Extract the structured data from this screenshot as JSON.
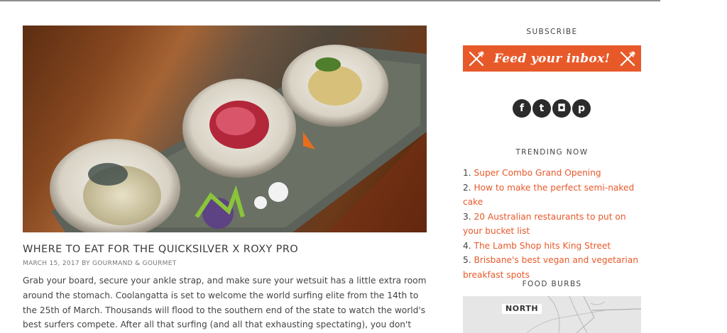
{
  "article": {
    "title": "WHERE TO EAT FOR THE QUICKSILVER X ROXY PRO",
    "meta": "MARCH 15, 2017 BY GOURMAND & GOURMET",
    "excerpt": "Grab your board, secure your ankle strap, and make sure your wetsuit has a little extra room around the stomach. Coolangatta is set to welcome the world surfing elite from the 14th to the 25th of March. Thousands will flood to the southern end of the state to watch the world's best surfers compete. After all that surfing (and all that exhausting spectating), you don't want to be hunting around all day and"
  },
  "sidebar": {
    "subscribe": {
      "heading": "SUBSCRIBE",
      "banner_text": "Feed your inbox!",
      "accent": "#e8592a"
    },
    "socials": [
      {
        "icon": "facebook-icon",
        "glyph": "f"
      },
      {
        "icon": "twitter-icon",
        "glyph": "t"
      },
      {
        "icon": "instagram-icon",
        "glyph": "◘"
      },
      {
        "icon": "pinterest-icon",
        "glyph": "p"
      }
    ],
    "trending": {
      "heading": "TRENDING NOW",
      "items": [
        {
          "num": "1.",
          "label": "Super Combo Grand Opening"
        },
        {
          "num": "2.",
          "label": "How to make the perfect semi-naked cake"
        },
        {
          "num": "3.",
          "label": "20 Australian restaurants to put on your bucket list"
        },
        {
          "num": "4.",
          "label": "The Lamb Shop hits King Street"
        },
        {
          "num": "5.",
          "label": "Brisbane's best vegan and vegetarian breakfast spots"
        }
      ]
    },
    "food_burbs": {
      "heading": "FOOD BURBS",
      "map_label": "NORTH"
    }
  }
}
